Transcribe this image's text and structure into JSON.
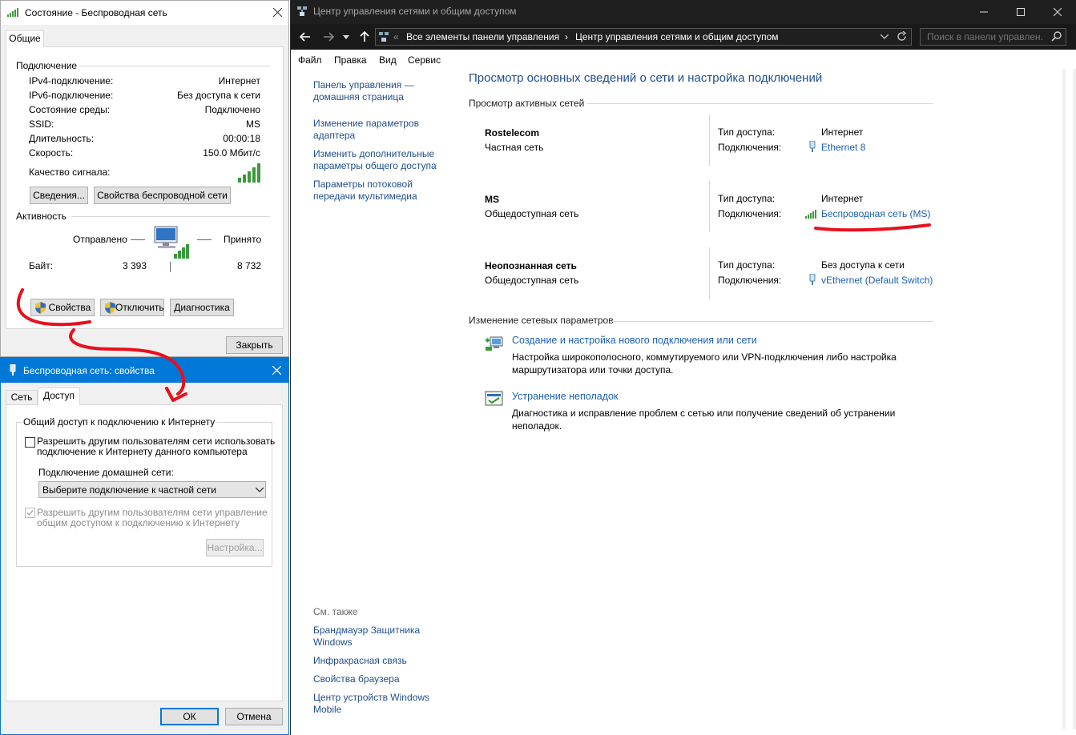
{
  "nsc": {
    "window_title": "Центр управления сетями и общим доступом",
    "breadcrumb_prefix": "«",
    "breadcrumb_1": "Все элементы панели управления",
    "breadcrumb_sep": "›",
    "breadcrumb_2": "Центр управления сетями и общим доступом",
    "search_placeholder": "Поиск в панели управлен...",
    "menu": [
      "Файл",
      "Правка",
      "Вид",
      "Сервис"
    ],
    "sidebar": {
      "home": "Панель управления —\nдомашняя страница",
      "items": [
        "Изменение параметров\nадаптера",
        "Изменить дополнительные\nпараметры общего доступа",
        "Параметры потоковой\nпередачи мультимедиа"
      ],
      "see_also_header": "См. также",
      "see_also": [
        "Брандмауэр Защитника\nWindows",
        "Инфракрасная связь",
        "Свойства браузера",
        "Центр устройств Windows\nMobile"
      ]
    },
    "main_title": "Просмотр основных сведений о сети и настройка подключений",
    "active_networks_header": "Просмотр активных сетей",
    "access_type_label": "Тип доступа:",
    "connections_label": "Подключения:",
    "networks": [
      {
        "name": "Rostelecom",
        "category": "Частная сеть",
        "access": "Интернет",
        "connection": "Ethernet 8"
      },
      {
        "name": "MS",
        "category": "Общедоступная сеть",
        "access": "Интернет",
        "connection": "Беспроводная сеть (MS)"
      },
      {
        "name": "Неопознанная сеть",
        "category": "Общедоступная сеть",
        "access": "Без доступа к сети",
        "connection": "vEthernet (Default Switch)"
      }
    ],
    "change_settings_header": "Изменение сетевых параметров",
    "tasks": [
      {
        "title": "Создание и настройка нового подключения или сети",
        "desc": "Настройка широкополосного, коммутируемого или VPN-подключения либо настройка\nмаршрутизатора или точки доступа."
      },
      {
        "title": "Устранение неполадок",
        "desc": "Диагностика и исправление проблем с сетью или получение сведений об устранении\nнеполадок."
      }
    ]
  },
  "status": {
    "window_title": "Состояние - Беспроводная сеть",
    "tab": "Общие",
    "connection_group": "Подключение",
    "rows": [
      {
        "label": "IPv4-подключение:",
        "value": "Интернет"
      },
      {
        "label": "IPv6-подключение:",
        "value": "Без доступа к сети"
      },
      {
        "label": "Состояние среды:",
        "value": "Подключено"
      },
      {
        "label": "SSID:",
        "value": "MS"
      },
      {
        "label": "Длительность:",
        "value": "00:00:18"
      },
      {
        "label": "Скорость:",
        "value": "150.0 Мбит/с"
      }
    ],
    "signal_label": "Качество сигнала:",
    "details_button": "Сведения...",
    "wireless_props_button": "Свойства беспроводной сети",
    "activity_group": "Активность",
    "sent_label": "Отправлено",
    "received_label": "Принято",
    "bytes_label": "Байт:",
    "bytes_sent": "3 393",
    "bytes_received": "8 732",
    "properties_button": "Свойства",
    "disable_button": "Отключить",
    "diagnose_button": "Диагностика",
    "close_button": "Закрыть"
  },
  "props": {
    "window_title": "Беспроводная сеть: свойства",
    "tab_network": "Сеть",
    "tab_sharing": "Доступ",
    "group_title": "Общий доступ к подключению к Интернету",
    "allow_share": "Разрешить другим пользователям сети использовать\nподключение к Интернету данного компьютера",
    "home_conn_label": "Подключение домашней сети:",
    "home_conn_value": "Выберите подключение к частной сети",
    "allow_control": "Разрешить другим пользователям сети управление\nобщим доступом к подключению к Интернету",
    "settings_button": "Настройка...",
    "ok_button": "ОК",
    "cancel_button": "Отмена"
  }
}
